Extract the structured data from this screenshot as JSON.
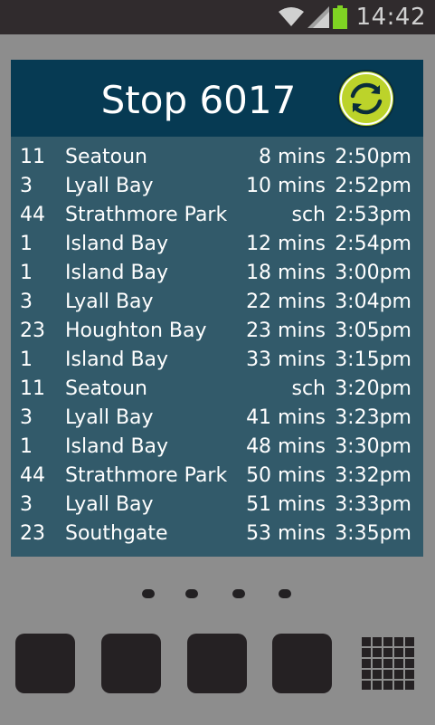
{
  "status_bar": {
    "time": "14:42",
    "icons": [
      "wifi-icon",
      "signal-icon",
      "battery-icon"
    ],
    "battery_color": "#7fd323"
  },
  "widget": {
    "title": "Stop 6017",
    "refresh_icon": "refresh-icon",
    "colors": {
      "header": "#063a53",
      "body": "#325a6a",
      "accent": "#bcd32a"
    },
    "departures": [
      {
        "route": "11",
        "destination": "Seatoun",
        "due": "8 mins",
        "time": "2:50pm"
      },
      {
        "route": "3",
        "destination": "Lyall Bay",
        "due": "10 mins",
        "time": "2:52pm"
      },
      {
        "route": "44",
        "destination": "Strathmore Park",
        "due": "sch",
        "time": "2:53pm"
      },
      {
        "route": "1",
        "destination": "Island Bay",
        "due": "12 mins",
        "time": "2:54pm"
      },
      {
        "route": "1",
        "destination": "Island Bay",
        "due": "18 mins",
        "time": "3:00pm"
      },
      {
        "route": "3",
        "destination": "Lyall Bay",
        "due": "22 mins",
        "time": "3:04pm"
      },
      {
        "route": "23",
        "destination": "Houghton Bay",
        "due": "23 mins",
        "time": "3:05pm"
      },
      {
        "route": "1",
        "destination": "Island Bay",
        "due": "33 mins",
        "time": "3:15pm"
      },
      {
        "route": "11",
        "destination": "Seatoun",
        "due": "sch",
        "time": "3:20pm"
      },
      {
        "route": "3",
        "destination": "Lyall Bay",
        "due": "41 mins",
        "time": "3:23pm"
      },
      {
        "route": "1",
        "destination": "Island Bay",
        "due": "48 mins",
        "time": "3:30pm"
      },
      {
        "route": "44",
        "destination": "Strathmore Park",
        "due": "50 mins",
        "time": "3:32pm"
      },
      {
        "route": "3",
        "destination": "Lyall Bay",
        "due": "51 mins",
        "time": "3:33pm"
      },
      {
        "route": "23",
        "destination": "Southgate",
        "due": "53 mins",
        "time": "3:35pm"
      }
    ]
  },
  "home_screen": {
    "page_count": 4,
    "dock_buttons": 4,
    "app_drawer_icon": "app-grid-icon"
  }
}
